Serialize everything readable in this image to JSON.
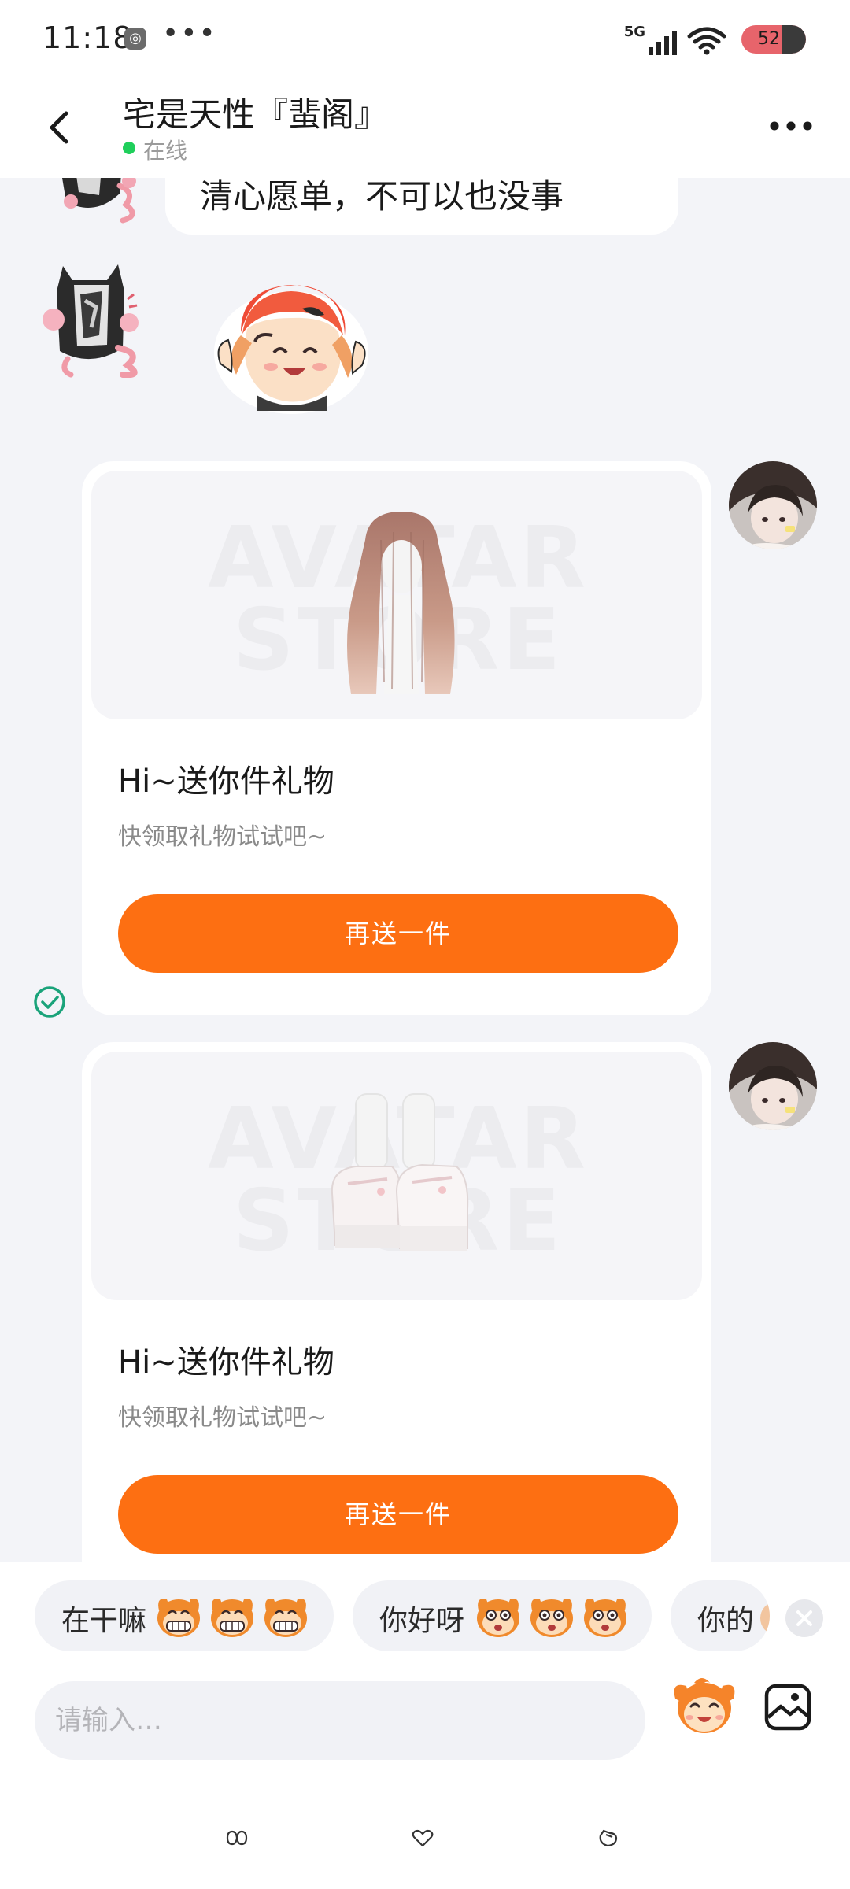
{
  "status_bar": {
    "time": "11:18",
    "app_icon": "app-notification-icon",
    "more": "•••",
    "network": "5G",
    "battery": "52",
    "icons": [
      "signal-icon",
      "wifi-icon",
      "battery-icon"
    ]
  },
  "header": {
    "back_icon": "back-arrow-icon",
    "title": "宅是天性『蜚阁』",
    "status": "在线",
    "status_color": "#1fcf5b",
    "more_icon": "more-dots-icon"
  },
  "messages": {
    "text_message": "清心愿单，不可以也没事",
    "sticker": "sticker-chibi-girl",
    "gift_cards": [
      {
        "item": "long-brown-hair-wig",
        "watermark": "AVATAR STORE",
        "title": "Hi~送你件礼物",
        "subtitle": "快领取礼物试试吧~",
        "button": "再送一件"
      },
      {
        "item": "white-platform-shoes",
        "watermark": "AVATAR STORE",
        "title": "Hi~送你件礼物",
        "subtitle": "快领取礼物试试吧~",
        "button": "再送一件"
      }
    ],
    "read_status_icon": "check-circle-icon"
  },
  "quick_replies": [
    {
      "label": "在干嘛",
      "emoji": "grinning-monkey-icon"
    },
    {
      "label": "你好呀",
      "emoji": "surprised-monkey-icon"
    },
    {
      "label": "你的"
    }
  ],
  "composer": {
    "placeholder": "请输入…",
    "sticker_icon": "monkey-sticker-icon",
    "image_icon": "image-icon"
  },
  "colors": {
    "accent": "#fd6f12",
    "background": "#f3f4f8",
    "online": "#1fcf5b",
    "read_check": "#1aa37a"
  },
  "nav_bar": [
    "nav-recents-icon",
    "nav-home-icon",
    "nav-back-icon"
  ]
}
